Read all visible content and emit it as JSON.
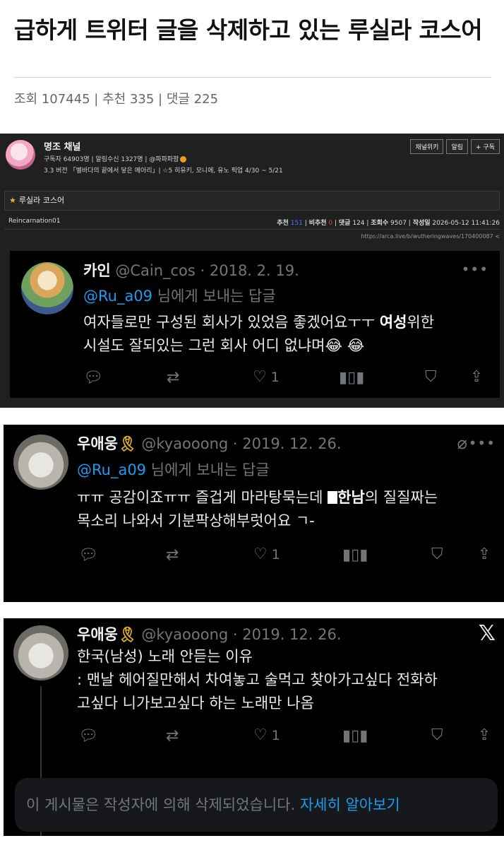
{
  "article": {
    "title": "급하게 트위터 글을 삭제하고 있는 루실라 코스어",
    "views_label": "조회",
    "views": "107445",
    "recommend_label": "추천",
    "recommend": "335",
    "comments_label": "댓글",
    "comments": "225"
  },
  "channel": {
    "name": "명조 채널",
    "subscribers": "구독자 64903명",
    "notifications": "알림수신 1327명",
    "owner": "@파파파팜",
    "notice": "3.3 버전 「별바다의 끝에서 닿은 메아리」| ☆5 히유키, 모니에, 유노 픽업 4/30 ~ 5/21",
    "buttons": [
      "채널위키",
      "알림",
      "+ 구독"
    ]
  },
  "post": {
    "title": "루실라 코스어",
    "author": "Reincarnation01",
    "recommend_label": "추천",
    "recommend": "151",
    "unrecommend_label": "비추천",
    "unrecommend": "0",
    "comments_label": "댓글",
    "comments": "124",
    "views_label": "조회수",
    "views": "9507",
    "date_label": "작성일",
    "date": "2026-05-12 11:41:26",
    "url": "https://arca.live/b/wutheringwaves/170400087"
  },
  "tweets": [
    {
      "name": "카인",
      "handle": "@Cain_cos · 2018. 2. 19.",
      "reply_mention": "@Ru_a09",
      "reply_text": "님에게 보내는 답글",
      "line1_pre": "여자들로만 구성된 회사가 있었음 좋겠어요ㅜㅜ ",
      "line1_bold": "여성",
      "line1_post": "위한",
      "line2": "시설도 잘되있는 그런 회사 어디 없냐며😂 😂",
      "likes": "1"
    },
    {
      "name": "우애웅",
      "handle": "@kyaooong · 2019. 12. 26.",
      "reply_mention": "@Ru_a09",
      "reply_text": "님에게 보내는 답글",
      "line1_pre": "ㅠㅠ 공감이죠ㅠㅠ 즐겁게 마라탕묵는데 ",
      "line1_bold": "한남",
      "line1_post": "의 질질짜는",
      "line2": "목소리 나와서 기분팍상해부럿어요 ㄱ-",
      "likes": "1"
    },
    {
      "name": "우애웅",
      "handle": "@kyaooong · 2019. 12. 26.",
      "line1": "한국(남성) 노래 안듣는 이유",
      "line2": ": 맨날 헤어질만해서 차여놓고 술먹고 찾아가고싶다 전화하",
      "line3": "고싶다 니가보고싶다 하는 노래만 나옴",
      "likes": "1",
      "deleted_notice": "이 게시물은 작성자에 의해 삭제되었습니다.",
      "learn_more": "자세히 알아보기"
    }
  ],
  "icons": [
    "reply-icon",
    "retweet-icon",
    "like-icon",
    "views-icon",
    "bookmark-icon",
    "share-icon",
    "more-icon",
    "mute-icon",
    "x-logo-icon",
    "ribbon-icon"
  ],
  "colors": {
    "mention": "#1d9bf0",
    "muted": "#71767b",
    "recommend_count": "#3b82f6",
    "unrecommend_count": "#e14040"
  }
}
